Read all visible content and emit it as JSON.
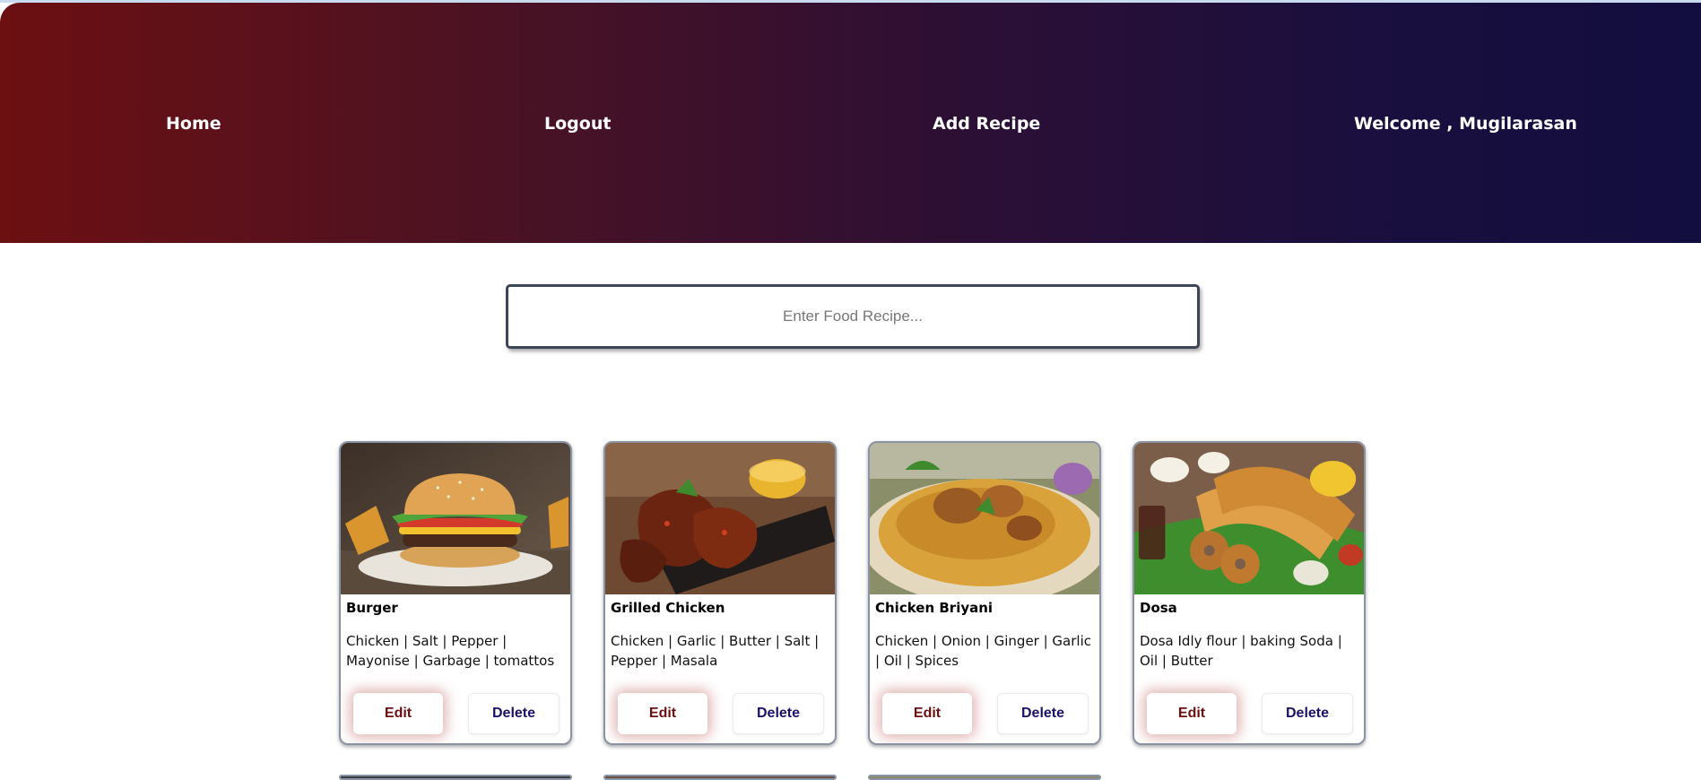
{
  "nav": {
    "home": "Home",
    "logout": "Logout",
    "add_recipe": "Add Recipe",
    "welcome": "Welcome , Mugilarasan"
  },
  "search": {
    "placeholder": "Enter Food Recipe..."
  },
  "recipes": [
    {
      "title": "Burger",
      "ingredients": "Chicken | Salt | Pepper | Mayonise | Garbage | tomattos",
      "edit_label": "Edit",
      "delete_label": "Delete",
      "image": "burger-photo"
    },
    {
      "title": "Grilled Chicken",
      "ingredients": "Chicken | Garlic | Butter | Salt | Pepper | Masala",
      "edit_label": "Edit",
      "delete_label": "Delete",
      "image": "grilled-chicken-photo"
    },
    {
      "title": "Chicken Briyani",
      "ingredients": "Chicken | Onion | Ginger | Garlic | Oil | Spices",
      "edit_label": "Edit",
      "delete_label": "Delete",
      "image": "chicken-briyani-photo"
    },
    {
      "title": "Dosa",
      "ingredients": "Dosa Idly flour | baking Soda | Oil | Butter",
      "edit_label": "Edit",
      "delete_label": "Delete",
      "image": "dosa-photo"
    }
  ],
  "colors": {
    "nav_gradient_start": "#6c1012",
    "nav_gradient_end": "#120e3f",
    "edit_text": "#6b0f10",
    "delete_text": "#1a1268"
  }
}
